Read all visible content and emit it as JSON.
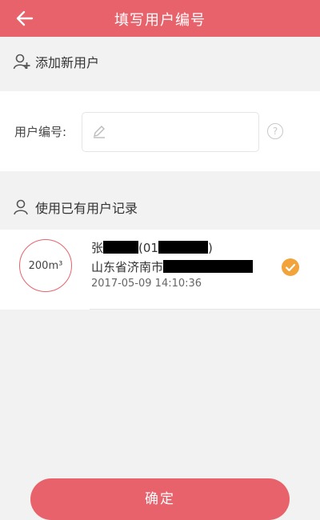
{
  "header": {
    "title": "填写用户编号"
  },
  "add_section": {
    "title": "添加新用户"
  },
  "user_id": {
    "label": "用户编号:",
    "value": "",
    "placeholder": ""
  },
  "existing_section": {
    "title": "使用已有用户记录"
  },
  "records": [
    {
      "volume": "200m³",
      "name_prefix": "张",
      "name_middle": "(01",
      "name_suffix": ")",
      "address_prefix": "山东省济南市",
      "timestamp": "2017-05-09 14:10:36",
      "selected": true
    }
  ],
  "confirm_button": {
    "label": "确定"
  },
  "colors": {
    "accent": "#e8626c",
    "check": "#f2a43a"
  }
}
